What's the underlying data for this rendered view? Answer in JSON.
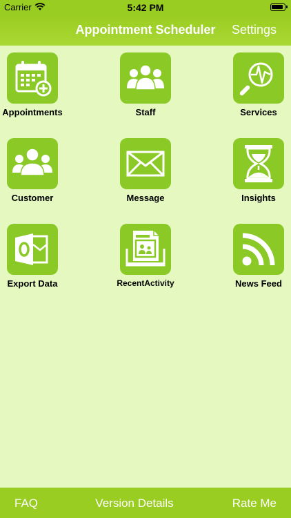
{
  "status_bar": {
    "carrier": "Carrier",
    "time": "5:42 PM"
  },
  "nav": {
    "title": "Appointment Scheduler",
    "settings": "Settings"
  },
  "tiles": [
    {
      "label": "Appointments",
      "icon": "calendar-add-icon"
    },
    {
      "label": "Staff",
      "icon": "staff-group-icon"
    },
    {
      "label": "Services",
      "icon": "services-magnifier-icon"
    },
    {
      "label": "Customer",
      "icon": "customer-group-icon"
    },
    {
      "label": "Message",
      "icon": "envelope-icon"
    },
    {
      "label": "Insights",
      "icon": "hourglass-icon"
    },
    {
      "label": "Export Data",
      "icon": "outlook-export-icon"
    },
    {
      "label": "RecentActivity",
      "icon": "recent-activity-icon"
    },
    {
      "label": "News Feed",
      "icon": "rss-icon"
    }
  ],
  "bottom": {
    "faq": "FAQ",
    "version": "Version Details",
    "rate": "Rate Me"
  },
  "colors": {
    "bar": "#9acd22",
    "tile": "#8ac926",
    "background": "#e4f8c0"
  }
}
